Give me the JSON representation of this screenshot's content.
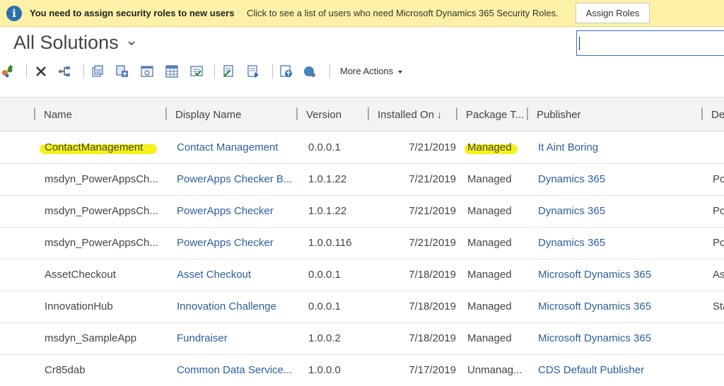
{
  "notification": {
    "icon": "info-icon",
    "title": "You need to assign security roles to new users",
    "message": "Click to see a list of users who need Microsoft Dynamics 365 Security Roles.",
    "button_label": "Assign Roles"
  },
  "view": {
    "title": "All Solutions"
  },
  "search": {
    "value": "",
    "placeholder": ""
  },
  "toolbar": {
    "icons": [
      "new-solution-icon",
      "delete-icon",
      "show-dependencies-icon",
      "export-icon",
      "import-icon",
      "publish-icon",
      "solution-table-icon",
      "clone-icon",
      "apply-patch-icon",
      "upgrade-icon",
      "import-package-icon",
      "web-resources-icon"
    ],
    "more_actions_label": "More Actions"
  },
  "grid": {
    "columns": [
      "Name",
      "Display Name",
      "Version",
      "Installed On",
      "Package T...",
      "Publisher",
      "De"
    ],
    "sort_indicator": "↓",
    "rows": [
      {
        "name": "ContactManagement",
        "display_name": "Contact Management",
        "version": "0.0.0.1",
        "installed_on": "7/21/2019",
        "package_type": "Managed",
        "publisher": "It Aint Boring",
        "description": ""
      },
      {
        "name": "msdyn_PowerAppsCh...",
        "display_name": "PowerApps Checker B...",
        "version": "1.0.1.22",
        "installed_on": "7/21/2019",
        "package_type": "Managed",
        "publisher": "Dynamics 365",
        "description": "Po"
      },
      {
        "name": "msdyn_PowerAppsCh...",
        "display_name": "PowerApps Checker",
        "version": "1.0.1.22",
        "installed_on": "7/21/2019",
        "package_type": "Managed",
        "publisher": "Dynamics 365",
        "description": "Po"
      },
      {
        "name": "msdyn_PowerAppsCh...",
        "display_name": "PowerApps Checker",
        "version": "1.0.0.116",
        "installed_on": "7/21/2019",
        "package_type": "Managed",
        "publisher": "Dynamics 365",
        "description": "Po"
      },
      {
        "name": "AssetCheckout",
        "display_name": "Asset Checkout",
        "version": "0.0.0.1",
        "installed_on": "7/18/2019",
        "package_type": "Managed",
        "publisher": "Microsoft Dynamics 365",
        "description": "As"
      },
      {
        "name": "InnovationHub",
        "display_name": "Innovation Challenge",
        "version": "0.0.0.1",
        "installed_on": "7/18/2019",
        "package_type": "Managed",
        "publisher": "Microsoft Dynamics 365",
        "description": "Sta"
      },
      {
        "name": "msdyn_SampleApp",
        "display_name": "Fundraiser",
        "version": "1.0.0.2",
        "installed_on": "7/18/2019",
        "package_type": "Managed",
        "publisher": "Microsoft Dynamics 365",
        "description": ""
      },
      {
        "name": "Cr85dab",
        "display_name": "Common Data Service...",
        "version": "1.0.0.0",
        "installed_on": "7/17/2019",
        "package_type": "Unmanag...",
        "publisher": "CDS Default Publisher",
        "description": ""
      }
    ]
  },
  "colors": {
    "notification_bg": "#fcf1a6",
    "link": "#2b5f9e",
    "highlight": "#f4f218",
    "header_bg": "#f3f3f3"
  }
}
